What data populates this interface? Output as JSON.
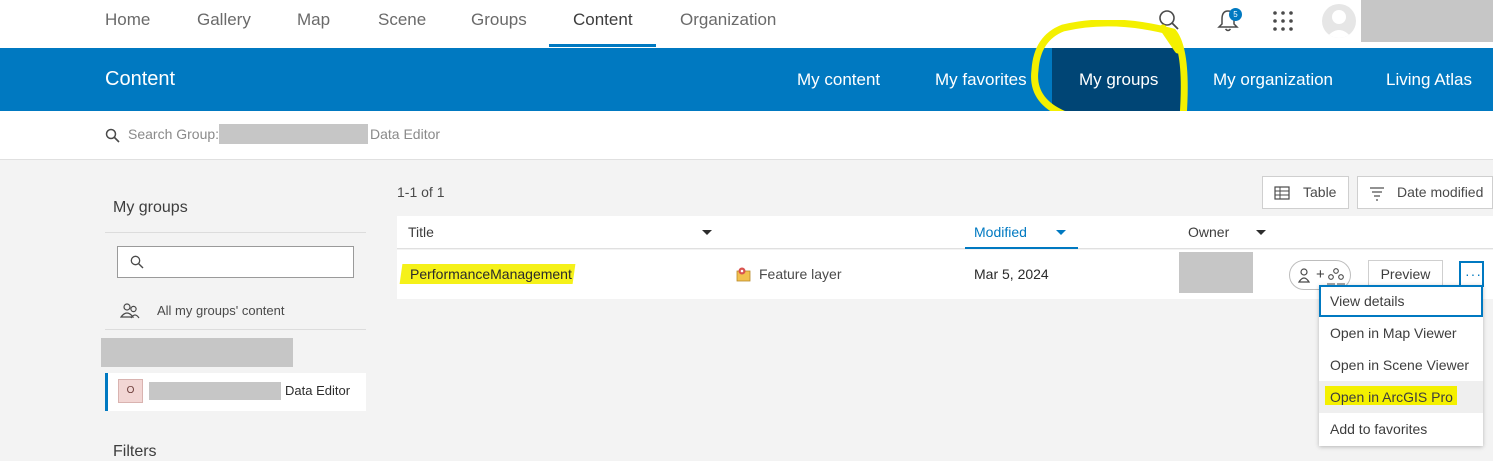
{
  "topnav": {
    "items": [
      "Home",
      "Gallery",
      "Map",
      "Scene",
      "Groups",
      "Content",
      "Organization"
    ],
    "active": "Content",
    "notifications_count": "5"
  },
  "content_bar": {
    "title": "Content",
    "tabs": [
      "My content",
      "My favorites",
      "My groups",
      "My organization",
      "Living Atlas"
    ],
    "active_tab": "My groups"
  },
  "search": {
    "prefix": "Search Group:",
    "suffix": "Data Editor"
  },
  "sidebar": {
    "title": "My groups",
    "all_groups_label": "All my groups' content",
    "group_icon_letter": "O",
    "group_label_suffix": "Data Editor",
    "filters_title": "Filters"
  },
  "results": {
    "count": "1-1 of 1",
    "view_button": "Table",
    "sort_button": "Date modified"
  },
  "table": {
    "columns": {
      "title": "Title",
      "modified": "Modified",
      "owner": "Owner"
    },
    "rows": [
      {
        "title": "PerformanceManagement",
        "type": "Feature layer",
        "modified": "Mar 5, 2024",
        "share_label": "+",
        "preview_label": "Preview",
        "more_label": "···"
      }
    ]
  },
  "dropdown": {
    "items": [
      "View details",
      "Open in Map Viewer",
      "Open in Scene Viewer",
      "Open in ArcGIS Pro",
      "Add to favorites"
    ]
  },
  "colors": {
    "brand_blue": "#0079c1",
    "active_tab_dark": "#004575",
    "highlight_yellow": "#f4f000"
  }
}
